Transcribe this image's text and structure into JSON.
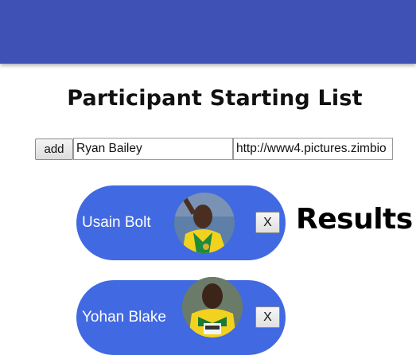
{
  "header": {
    "color": "#3f51b5"
  },
  "page": {
    "title": "Participant Starting List"
  },
  "form": {
    "add_label": "add",
    "name_value": "Ryan Bailey",
    "url_value": "http://www4.pictures.zimbio"
  },
  "participants": [
    {
      "name": "Usain Bolt",
      "remove_label": "X",
      "card_color": "#4169e1",
      "photo": "athlete-photo"
    },
    {
      "name": "Yohan Blake",
      "remove_label": "X",
      "card_color": "#4169e1",
      "photo": "athlete-photo"
    }
  ],
  "results": {
    "title": "Results"
  }
}
